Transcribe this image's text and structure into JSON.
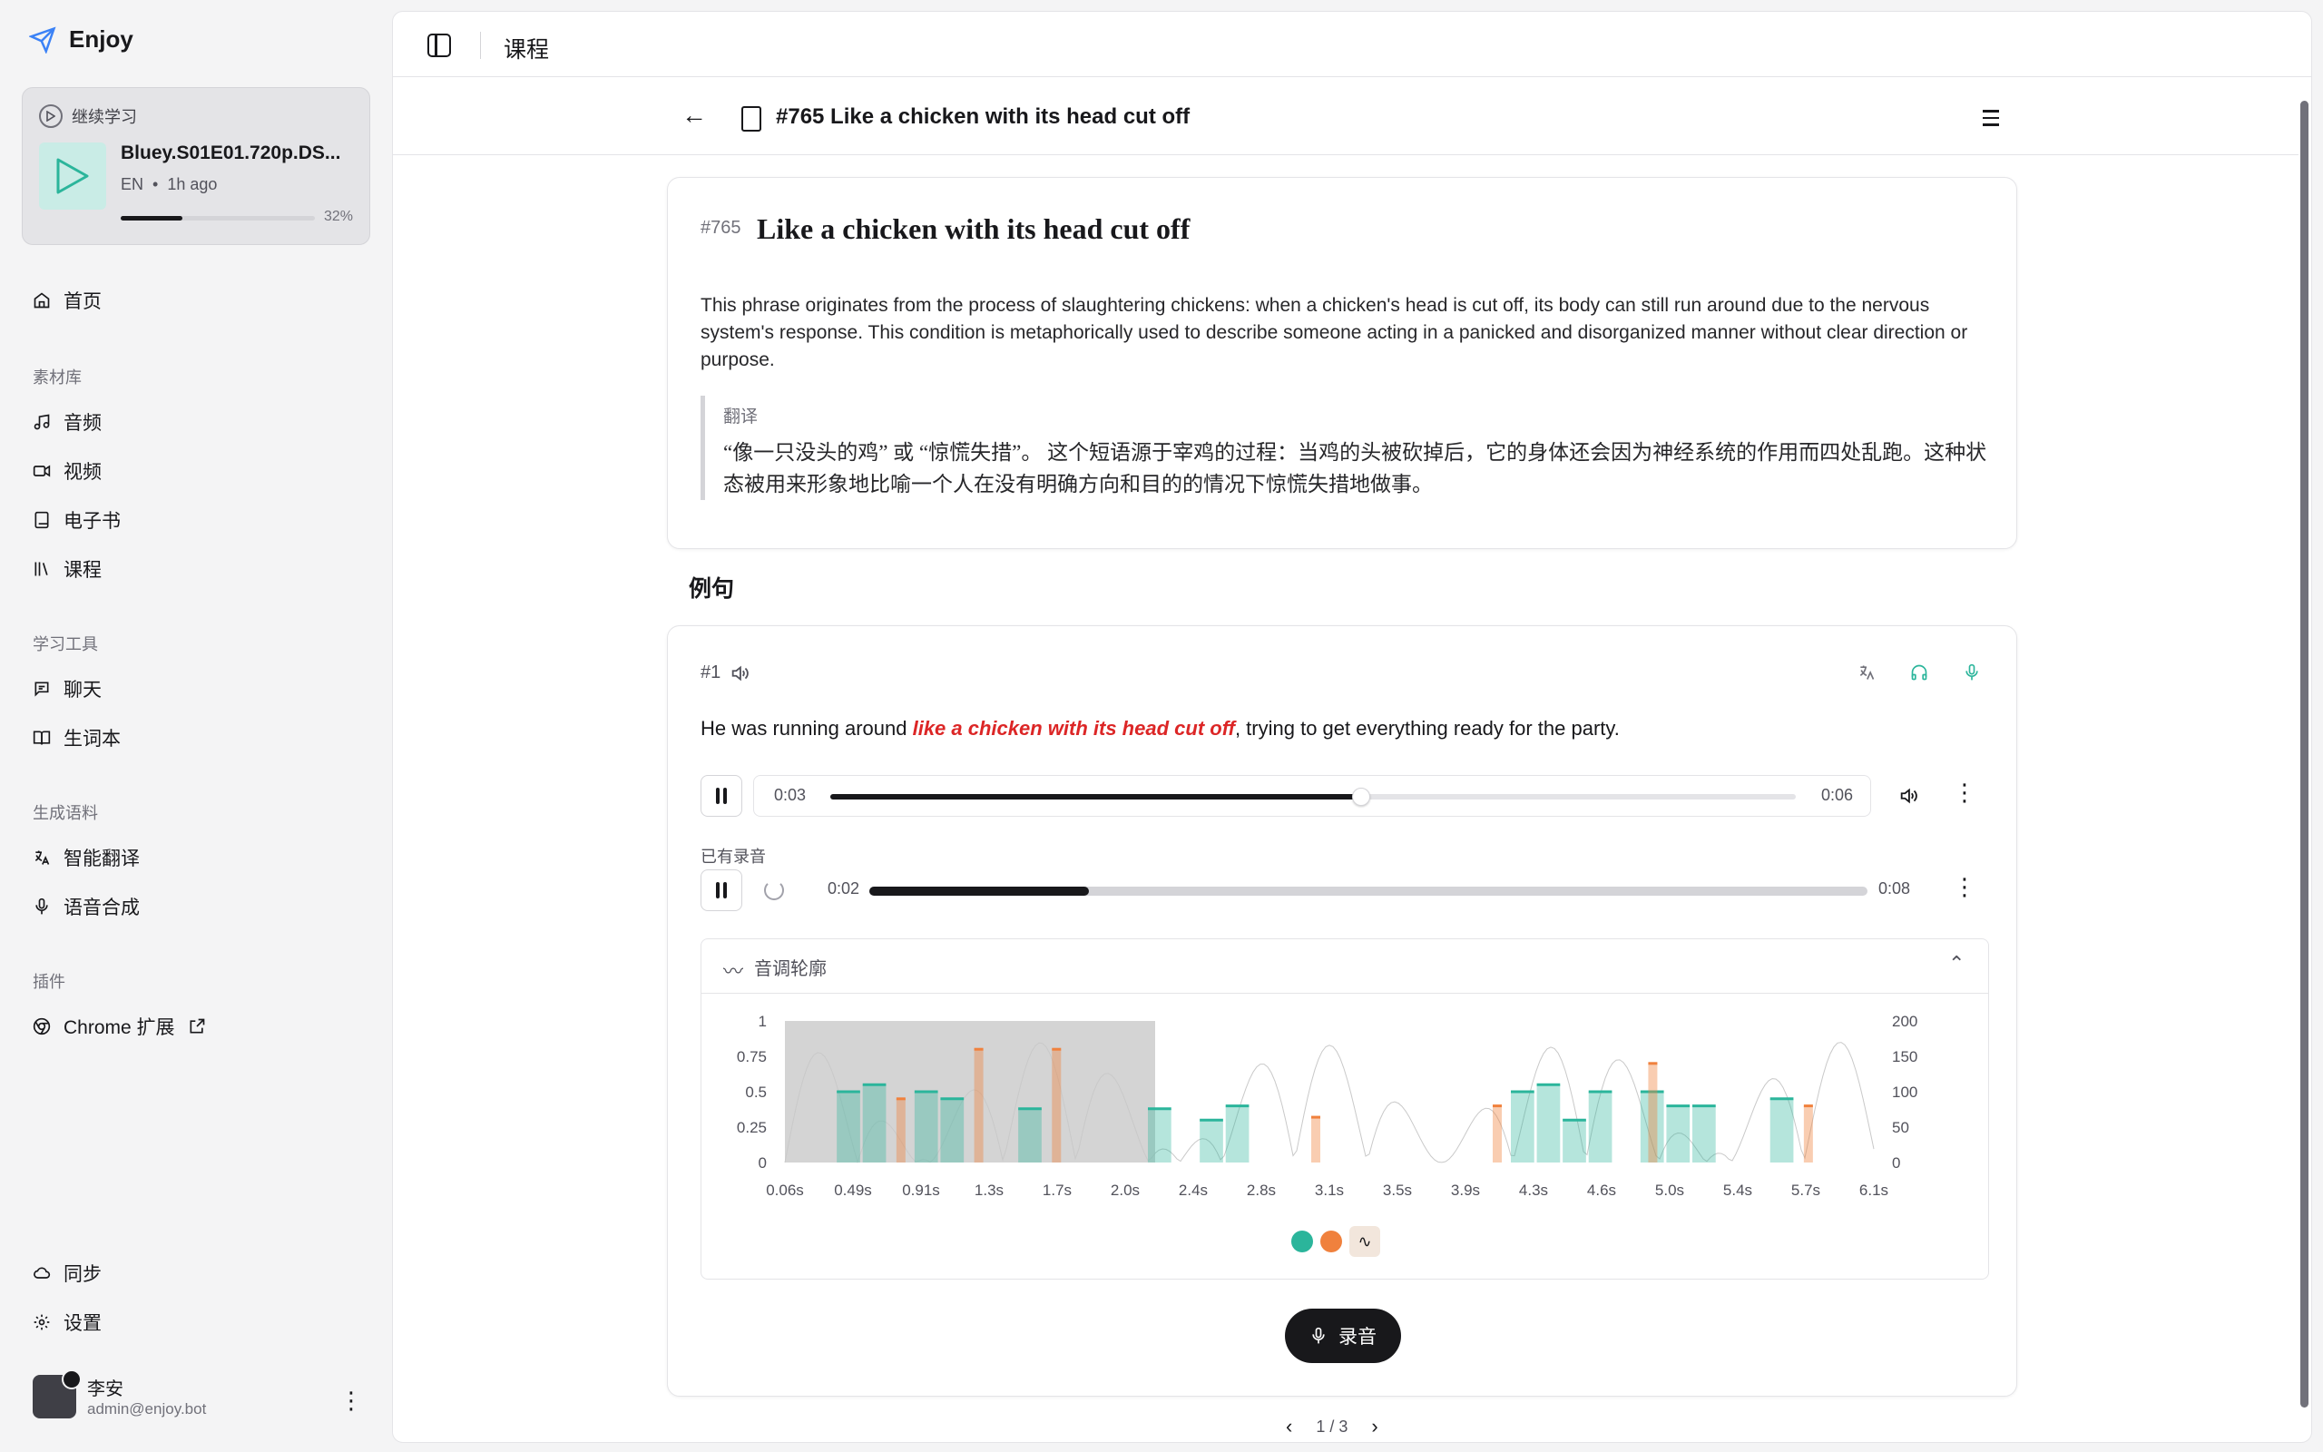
{
  "brand": {
    "name": "Enjoy"
  },
  "continue": {
    "header": "继续学习",
    "title": "Bluey.S01E01.720p.DS...",
    "lang": "EN",
    "time": "1h ago",
    "progress_pct": 32,
    "progress_label": "32%"
  },
  "nav": {
    "home": "首页",
    "group_library": "素材库",
    "audio": "音频",
    "video": "视频",
    "ebook": "电子书",
    "courses": "课程",
    "group_tools": "学习工具",
    "chat": "聊天",
    "vocab": "生词本",
    "group_gen": "生成语料",
    "translate": "智能翻译",
    "tts": "语音合成",
    "group_plugins": "插件",
    "chrome": "Chrome 扩展",
    "sync": "同步",
    "settings": "设置"
  },
  "user": {
    "name": "李安",
    "email": "admin@enjoy.bot"
  },
  "topbar": {
    "title": "课程"
  },
  "subheader": {
    "title": "#765 Like a chicken with its head cut off"
  },
  "phrase": {
    "num": "#765",
    "title": "Like a chicken with its head cut off",
    "description": "This phrase originates from the process of slaughtering chickens: when a chicken's head is cut off, its body can still run around due to the nervous system's response. This condition is metaphorically used to describe someone acting in a panicked and disorganized manner without clear direction or purpose.",
    "translation_label": "翻译",
    "translation": "“像一只没头的鸡” 或 “惊慌失措”。 这个短语源于宰鸡的过程：当鸡的头被砍掉后，它的身体还会因为神经系统的作用而四处乱跑。这种状态被用来形象地比喻一个人在没有明确方向和目的的情况下惊慌失措地做事。"
  },
  "examples_title": "例句",
  "example": {
    "num": "#1",
    "before": "He was running around ",
    "highlight": "like a chicken with its head cut off",
    "after": ", trying to get everything ready for the party.",
    "player": {
      "current": "0:03",
      "total": "0:06",
      "progress": 0.55
    },
    "recording_label": "已有录音",
    "recording": {
      "current": "0:02",
      "total": "0:08",
      "progress": 0.22
    },
    "pitch_label": "音调轮廓",
    "record_button": "录音"
  },
  "chart_data": {
    "type": "area",
    "title": "",
    "x_ticks": [
      "0.06s",
      "0.49s",
      "0.91s",
      "1.3s",
      "1.7s",
      "2.0s",
      "2.4s",
      "2.8s",
      "3.1s",
      "3.5s",
      "3.9s",
      "4.3s",
      "4.6s",
      "5.0s",
      "5.4s",
      "5.7s",
      "6.1s"
    ],
    "y_left_ticks": [
      "1",
      "0.75",
      "0.5",
      "0.25",
      "0"
    ],
    "y_right_ticks": [
      "200",
      "150",
      "100",
      "50",
      "0"
    ],
    "series": [
      {
        "color": "#2bb59b",
        "values": [
          0,
          0,
          0.5,
          0.55,
          0,
          0.5,
          0.45,
          0,
          0,
          0.38,
          0,
          0,
          0,
          0,
          0.38,
          0,
          0.3,
          0.4,
          0,
          0,
          0,
          0,
          0,
          0,
          0,
          0,
          0,
          0,
          0.5,
          0.55,
          0.3,
          0.5,
          0,
          0.5,
          0.4,
          0.4,
          0,
          0,
          0.45,
          0,
          0,
          0
        ]
      },
      {
        "color": "#f0813d",
        "values": [
          0,
          0,
          0,
          0,
          0.45,
          0,
          0,
          0.8,
          0,
          0,
          0.8,
          0,
          0,
          0,
          0,
          0,
          0,
          0,
          0,
          0,
          0.32,
          0,
          0,
          0,
          0,
          0,
          0,
          0.4,
          0,
          0,
          0,
          0,
          0,
          0.7,
          0,
          0,
          0,
          0,
          0,
          0.4,
          0,
          0
        ]
      }
    ],
    "legend_colors": [
      "#2bb59b",
      "#f0813d"
    ]
  },
  "pager": {
    "label": "1 / 3"
  }
}
